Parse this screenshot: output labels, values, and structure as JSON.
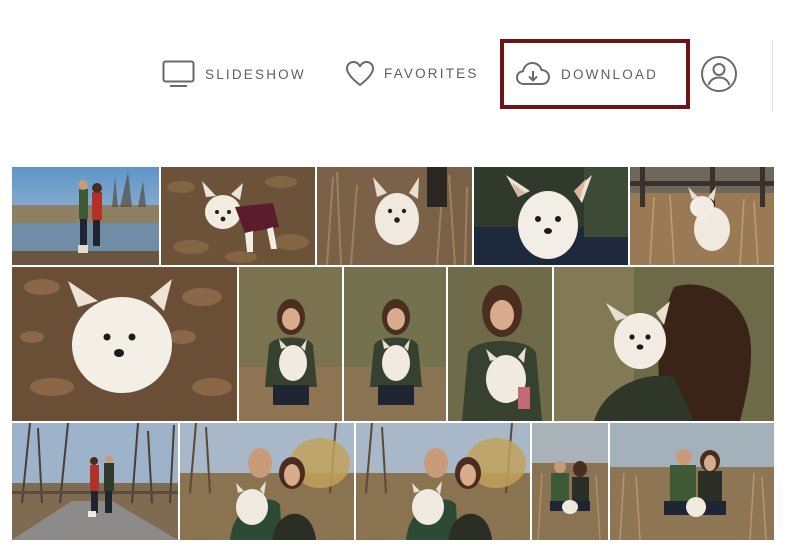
{
  "toolbar": {
    "slideshow_label": "SLIDESHOW",
    "favorites_label": "FAVORITES",
    "download_label": "DOWNLOAD",
    "icons": {
      "slideshow": "monitor-icon",
      "favorites": "heart-icon",
      "download": "cloud-download-icon",
      "account": "user-circle-icon"
    },
    "highlight_color": "#6e1417"
  },
  "gallery": {
    "photos": [
      {
        "id": "row1-couple-lake",
        "subject": "couple by lake"
      },
      {
        "id": "row1-dog-sweater",
        "subject": "dog in sweater on leaves"
      },
      {
        "id": "row1-dog-grass",
        "subject": "dog in grass"
      },
      {
        "id": "row1-dog-closeup",
        "subject": "dog closeup"
      },
      {
        "id": "row1-dog-fence",
        "subject": "dog by fence"
      },
      {
        "id": "row2-dog-leaves",
        "subject": "dog on leaves from above"
      },
      {
        "id": "row2-woman-dog-1",
        "subject": "woman holding dog"
      },
      {
        "id": "row2-woman-dog-2",
        "subject": "woman holding dog"
      },
      {
        "id": "row2-woman-dog-3",
        "subject": "woman with dog closeup"
      },
      {
        "id": "row2-dog-shoulder",
        "subject": "dog on woman's shoulder"
      },
      {
        "id": "row3-couple-path",
        "subject": "couple walking dog on path"
      },
      {
        "id": "row3-couple-dog-1",
        "subject": "couple holding dog"
      },
      {
        "id": "row3-couple-dog-2",
        "subject": "couple holding dog"
      },
      {
        "id": "row3-couple-sitting-1",
        "subject": "couple sitting with dog"
      },
      {
        "id": "row3-couple-sitting-2",
        "subject": "couple sitting with dog"
      }
    ]
  }
}
